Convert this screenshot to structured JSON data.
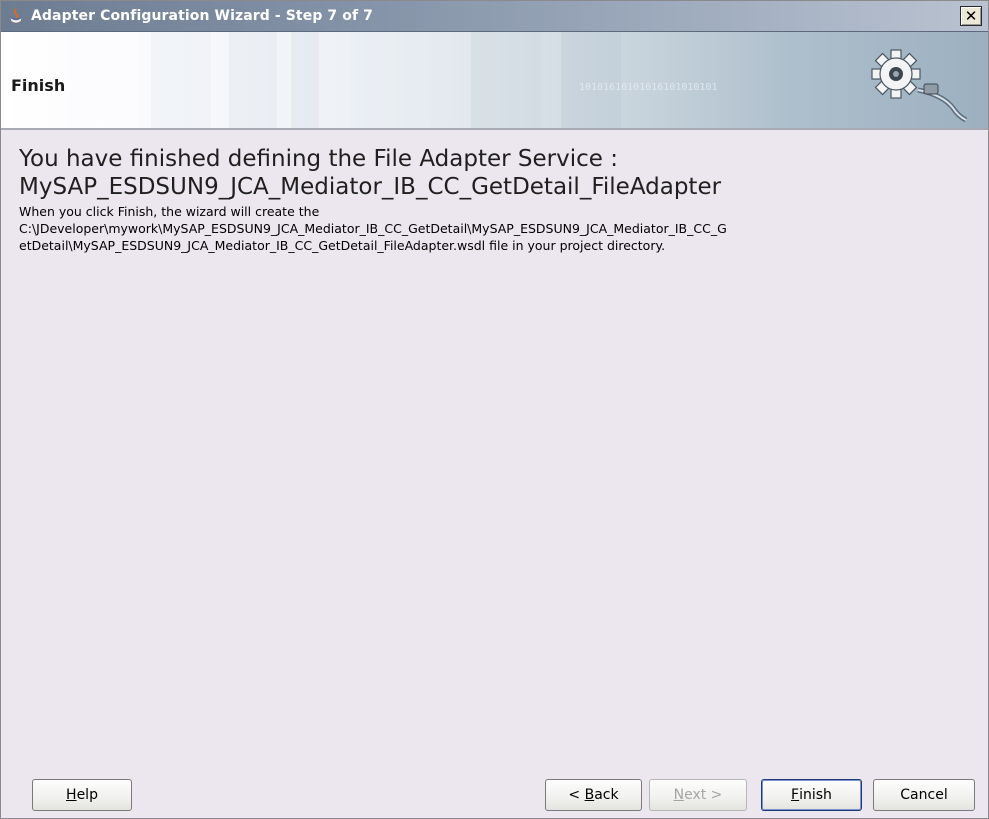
{
  "window": {
    "title": "Adapter Configuration Wizard - Step 7 of 7",
    "close_label": "✕"
  },
  "banner": {
    "title": "Finish",
    "binary_text": "10101610101016101010101"
  },
  "content": {
    "heading_line1": "You have finished defining the File Adapter Service :",
    "heading_line2": "MySAP_ESDSUN9_JCA_Mediator_IB_CC_GetDetail_FileAdapter",
    "body_line1": "When you click Finish, the wizard will create the",
    "body_line2": "C:\\JDeveloper\\mywork\\MySAP_ESDSUN9_JCA_Mediator_IB_CC_GetDetail\\MySAP_ESDSUN9_JCA_Mediator_IB_CC_G",
    "body_line3": "etDetail\\MySAP_ESDSUN9_JCA_Mediator_IB_CC_GetDetail_FileAdapter.wsdl file in your project directory."
  },
  "buttons": {
    "help": {
      "mnemonic": "H",
      "rest": "elp"
    },
    "back": {
      "prefix": "< ",
      "mnemonic": "B",
      "rest": "ack"
    },
    "next": {
      "mnemonic": "N",
      "rest": "ext >"
    },
    "finish": {
      "mnemonic": "F",
      "rest": "inish"
    },
    "cancel": {
      "label": "Cancel"
    }
  },
  "colors": {
    "window_bg": "#ece6ef",
    "titlebar": "#7b889d",
    "default_button_border": "#1f3a7a"
  }
}
